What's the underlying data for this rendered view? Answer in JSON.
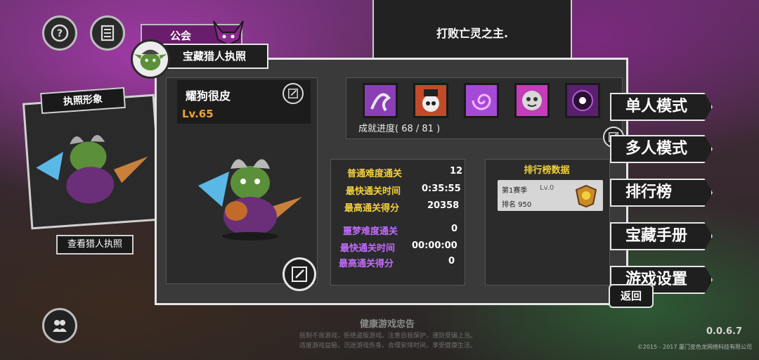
{
  "top_icons": [
    {
      "name": "help-icon"
    },
    {
      "name": "notes-icon"
    }
  ],
  "guild_tab": {
    "label": "公会"
  },
  "quest": {
    "text": "打败亡灵之主."
  },
  "panel": {
    "title": "宝藏猎人执照",
    "player_name": "耀狗很皮",
    "level": "Lv.65",
    "achievements": {
      "progress_text": "成就进度( 68 / 81 )",
      "badges": [
        {
          "name": "silver-snake-badge",
          "color": "#8a3fb5"
        },
        {
          "name": "skull-hat-badge",
          "color": "#c24a2a"
        },
        {
          "name": "purple-swirl-badge",
          "color": "#a44ad6"
        },
        {
          "name": "ghost-face-badge",
          "color": "#c43cb8"
        },
        {
          "name": "dark-eye-badge",
          "color": "#5a1f6e"
        }
      ]
    },
    "stats": {
      "normal": [
        {
          "label": "普通难度通关",
          "value": "12"
        },
        {
          "label": "最快通关时间",
          "value": "0:35:55"
        },
        {
          "label": "最高通关得分",
          "value": "20358"
        }
      ],
      "nightmare": [
        {
          "label": "噩梦难度通关",
          "value": "0"
        },
        {
          "label": "最快通关时间",
          "value": "00:00:00"
        },
        {
          "label": "最高通关得分",
          "value": "0"
        }
      ]
    },
    "leaderboard": {
      "title": "排行榜数据",
      "season": "第1赛季",
      "season_level": "Lv.0",
      "rank": "排名 950"
    }
  },
  "left_card": {
    "title": "执照形象",
    "view_button": "查看猎人执照"
  },
  "menu": [
    {
      "label": "单人模式"
    },
    {
      "label": "多人模式"
    },
    {
      "label": "排行榜"
    },
    {
      "label": "宝藏手册"
    },
    {
      "label": "游戏设置"
    }
  ],
  "back_button": "返回",
  "health_notice": {
    "title": "健康游戏忠告",
    "lines": [
      "抵制不良游戏，拒绝盗版游戏。注意自我保护，谨防受骗上当。",
      "适度游戏益脑，沉迷游戏伤身。合理安排时间，享受健康生活。"
    ]
  },
  "version": "0.0.6.7",
  "copyright": "©2015 - 2017 厦门变色龙网络科技有限公司",
  "colors": {
    "accent_yellow": "#f3d03b",
    "accent_purple": "#c46bff",
    "level_orange": "#f0a23a"
  }
}
